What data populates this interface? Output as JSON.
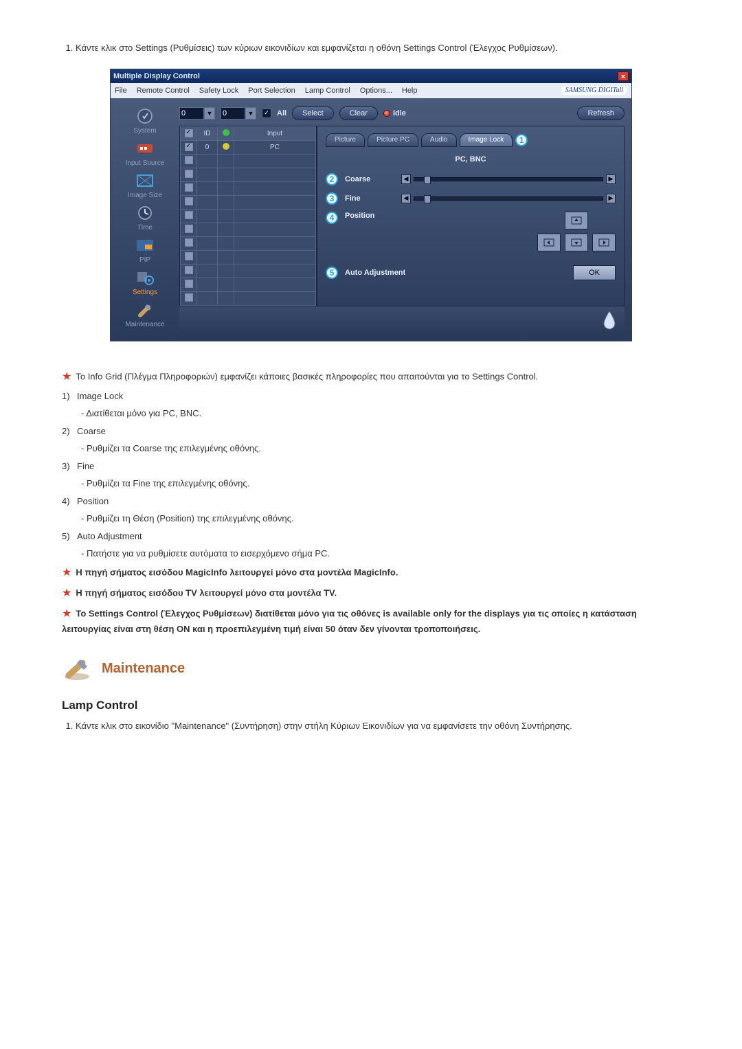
{
  "intro": {
    "num": "1.",
    "text": "Κάντε κλικ στο Settings (Ρυθμίσεις) των κύριων εικονιδίων και εμφανίζεται η οθόνη Settings Control (Έλεγχος Ρυθμίσεων)."
  },
  "app": {
    "title": "Multiple Display Control",
    "menu": {
      "file": "File",
      "remote": "Remote Control",
      "safety": "Safety Lock",
      "port": "Port Selection",
      "lamp": "Lamp Control",
      "options": "Options...",
      "help": "Help",
      "brand": "SAMSUNG DIGITall"
    },
    "sidebar": {
      "system": "System",
      "input_source": "Input Source",
      "image_size": "Image Size",
      "time": "Time",
      "pip": "PIP",
      "settings": "Settings",
      "maintenance": "Maintenance"
    },
    "top": {
      "combo1": "0",
      "combo2": "0",
      "all": "All",
      "select": "Select",
      "clear": "Clear",
      "idle": "Idle",
      "refresh": "Refresh"
    },
    "grid": {
      "col_id": "ID",
      "col_status": "",
      "col_input": "Input",
      "row0_id": "0",
      "row0_input": "PC"
    },
    "tabs": {
      "picture": "Picture",
      "picture_pc": "Picture PC",
      "audio": "Audio",
      "image_lock": "Image Lock"
    },
    "callouts": {
      "c1": "1",
      "c2": "2",
      "c3": "3",
      "c4": "4",
      "c5": "5"
    },
    "panel": {
      "heading": "PC, BNC",
      "coarse": "Coarse",
      "fine": "Fine",
      "position": "Position",
      "auto_adj": "Auto Adjustment",
      "ok": "OK"
    }
  },
  "notes": {
    "star1": "Το Info Grid (Πλέγμα Πληροφοριών) εμφανίζει κάποιες βασικές πληροφορίες που απαιτούνται για το Settings Control.",
    "n1_title": "Image Lock",
    "n1_sub": "- Διατίθεται μόνο για PC, BNC.",
    "n2_title": "Coarse",
    "n2_sub": "- Ρυθμίζει τα Coarse της επιλεγμένης οθόνης.",
    "n3_title": "Fine",
    "n3_sub": "- Ρυθμίζει τα Fine της επιλεγμένης οθόνης.",
    "n4_title": "Position",
    "n4_sub": "- Ρυθμίζει τη Θέση (Position) της επιλεγμένης οθόνης.",
    "n5_title": "Auto Adjustment",
    "n5_sub": "- Πατήστε για να ρυθμίσετε αυτόματα το εισερχόμενο σήμα PC.",
    "star2": "Η πηγή σήματος εισόδου MagicInfo λειτουργεί μόνο στα μοντέλα MagicInfo.",
    "star3": "Η πηγή σήματος εισόδου TV λειτουργεί μόνο στα μοντέλα TV.",
    "star4": "Το Settings Control (Έλεγχος Ρυθμίσεων) διατίθεται μόνο για τις οθόνες is available only for the displays για τις οποίες η κατάσταση λειτουργίας είναι στη θέση ON και η προεπιλεγμένη τιμή είναι 50 όταν δεν γίνονται τροποποιήσεις.",
    "num1": "1)",
    "num2": "2)",
    "num3": "3)",
    "num4": "4)",
    "num5": "5)"
  },
  "maintenance": {
    "heading": "Maintenance",
    "sub": "Lamp Control",
    "item1_num": "1.",
    "item1_text": "Κάντε κλικ στο εικονίδιο \"Maintenance\" (Συντήρηση) στην στήλη Κύριων Εικονιδίων για να εμφανίσετε την οθόνη Συντήρησης."
  }
}
